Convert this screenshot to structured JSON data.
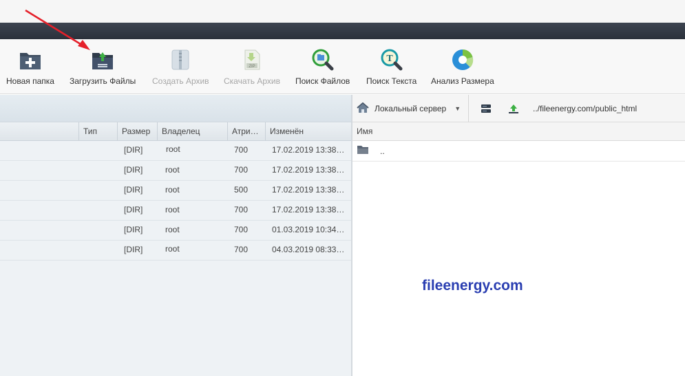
{
  "toolbar": {
    "buttons": [
      {
        "label": "Новая папка",
        "icon": "new-folder-icon",
        "enabled": true
      },
      {
        "label": "Загрузить Файлы",
        "icon": "upload-files-icon",
        "enabled": true
      },
      {
        "label": "Создать Архив",
        "icon": "archive-icon",
        "enabled": false
      },
      {
        "label": "Скачать Архив",
        "icon": "zip-download-icon",
        "enabled": false
      },
      {
        "label": "Поиск Файлов",
        "icon": "search-files-icon",
        "enabled": true
      },
      {
        "label": "Поиск Текста",
        "icon": "search-text-icon",
        "enabled": true
      },
      {
        "label": "Анализ Размера",
        "icon": "size-analysis-icon",
        "enabled": true
      }
    ]
  },
  "left_table": {
    "columns": [
      "Тип",
      "Размер",
      "Владелец",
      "Атри…",
      "Изменён"
    ],
    "rows": [
      {
        "type": "",
        "size": "[DIR]",
        "owner": "root",
        "attrs": "700",
        "modified": "17.02.2019 13:38…"
      },
      {
        "type": "",
        "size": "[DIR]",
        "owner": "root",
        "attrs": "700",
        "modified": "17.02.2019 13:38…"
      },
      {
        "type": "",
        "size": "[DIR]",
        "owner": "root",
        "attrs": "500",
        "modified": "17.02.2019 13:38…"
      },
      {
        "type": "",
        "size": "[DIR]",
        "owner": "root",
        "attrs": "700",
        "modified": "17.02.2019 13:38…"
      },
      {
        "type": "",
        "size": "[DIR]",
        "owner": "root",
        "attrs": "700",
        "modified": "01.03.2019 10:34…"
      },
      {
        "type": "",
        "size": "[DIR]",
        "owner": "root",
        "attrs": "700",
        "modified": "04.03.2019 08:33…"
      }
    ]
  },
  "right_pane": {
    "server_label": "Локальный сервер",
    "path": "../fileenergy.com/public_html",
    "column_name": "Имя",
    "parent_entry": ".."
  },
  "watermark": "fileenergy.com",
  "colors": {
    "accent_arrow": "#e5202a",
    "watermark": "#2a3eb1",
    "header_dark": "#2b313b"
  }
}
